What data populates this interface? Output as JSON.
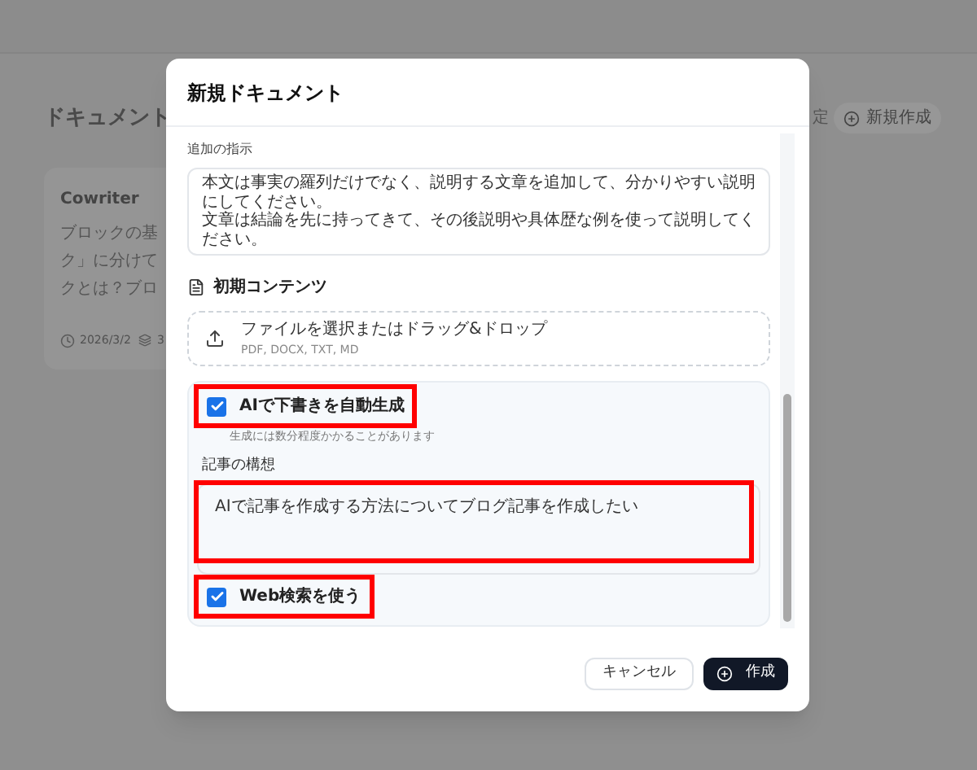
{
  "background": {
    "page_title": "ドキュメント",
    "header_partial": "定",
    "new_button": "新規作成",
    "card": {
      "title": "Cowriter",
      "lines": [
        "ブロックの基",
        "ク」に分けて",
        "クとは？ブロ"
      ],
      "date": "2026/3/2",
      "count": "3"
    }
  },
  "dialog": {
    "title": "新規ドキュメント",
    "instructions": {
      "label": "追加の指示",
      "lines": [
        "本文は事実の羅列だけでなく、説明する文章を追加して、分かりやすい説明にしてください。",
        "文章は結論を先に持ってきて、その後説明や具体歴な例を使って説明してください。"
      ]
    },
    "initial_content": {
      "heading": "初期コンテンツ",
      "dropzone_text": "ファイルを選択またはドラッグ&ドロップ",
      "formats": "PDF, DOCX, TXT, MD"
    },
    "auto_draft": {
      "label": "AIで下書きを自動生成",
      "checked": true,
      "highlighted": true,
      "hint": "生成には数分程度かかることがあります"
    },
    "concept": {
      "label": "記事の構想",
      "value": "AIで記事を作成する方法についてブログ記事を作成したい",
      "highlighted": true
    },
    "web_search": {
      "label": "Web検索を使う",
      "checked": true,
      "highlighted": true
    },
    "buttons": {
      "cancel": "キャンセル",
      "create": "作成"
    }
  }
}
